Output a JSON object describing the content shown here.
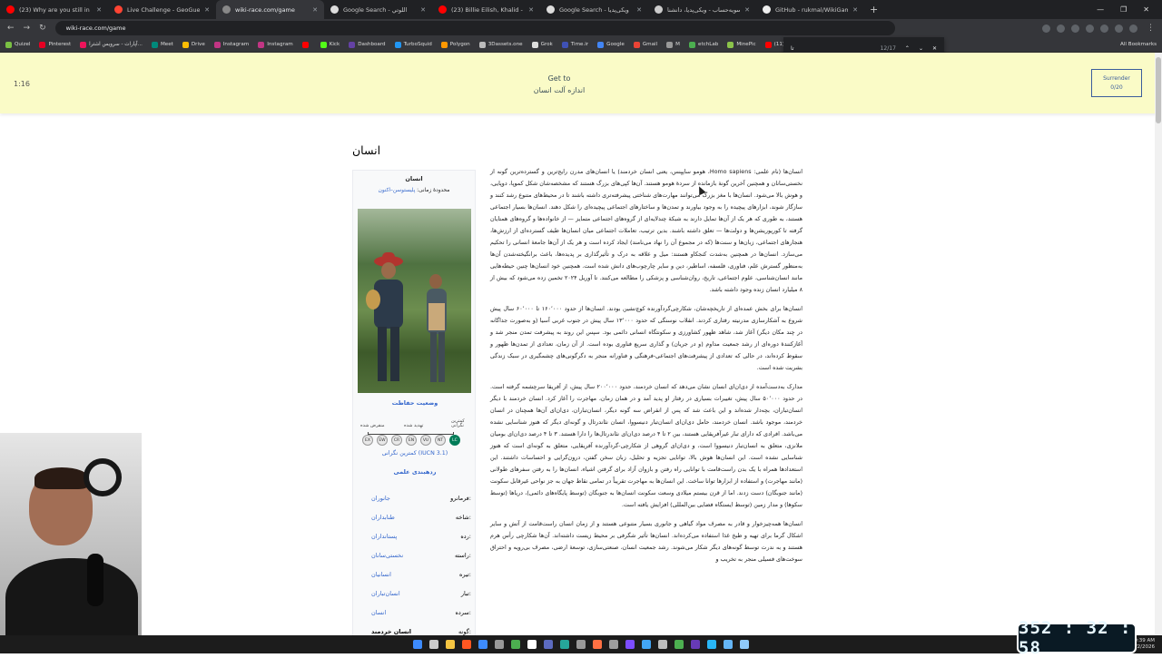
{
  "browser": {
    "tabs": [
      {
        "title": "(23) Why are you still in touch...",
        "fav": "#ff0000",
        "active": false
      },
      {
        "title": "Live Challenge - GeoGuessr",
        "fav": "#ff4433",
        "active": false
      },
      {
        "title": "wiki-race.com/game",
        "fav": "#888888",
        "active": true
      },
      {
        "title": "Google Search - اللوتي",
        "fav": "#dddddd",
        "active": false
      },
      {
        "title": "(23) Billie Eilish, Khalid - lo...",
        "fav": "#ff0000",
        "active": false
      },
      {
        "title": "Google Search - ویکی‌پدیا",
        "fav": "#dddddd",
        "active": false
      },
      {
        "title": "تسویه‌حساب - ویکی‌پدیا، دانشنا...",
        "fav": "#cccccc",
        "active": false
      },
      {
        "title": "GitHub - rukmal/WikiGameHe...",
        "fav": "#eeeeee",
        "active": false
      }
    ],
    "url": "wiki-race.com/game",
    "bookmarks": [
      {
        "label": "Quizel",
        "color": "#7ac043"
      },
      {
        "label": "Pinterest",
        "color": "#e60023"
      },
      {
        "label": "آپارات - سرویس اشترا...",
        "color": "#ed145b"
      },
      {
        "label": "Meet",
        "color": "#00897b"
      },
      {
        "label": "Drive",
        "color": "#fbbc04"
      },
      {
        "label": "Instagram",
        "color": "#c13584"
      },
      {
        "label": "Instagram",
        "color": "#c13584"
      },
      {
        "label": "",
        "color": "#ff0000"
      },
      {
        "label": "Kick",
        "color": "#53fc18"
      },
      {
        "label": "Dashboard",
        "color": "#6441a5"
      },
      {
        "label": "TurboSquid",
        "color": "#2196f3"
      },
      {
        "label": "Polygon",
        "color": "#ff9800"
      },
      {
        "label": "3Dassets.one",
        "color": "#bbbbbb"
      },
      {
        "label": "Grok",
        "color": "#dddddd"
      },
      {
        "label": "Time.ir",
        "color": "#3f51b5"
      },
      {
        "label": "Google",
        "color": "#4285f4"
      },
      {
        "label": "Gmail",
        "color": "#ea4335"
      },
      {
        "label": "M",
        "color": "#999999"
      },
      {
        "label": "etchLab",
        "color": "#4caf50"
      },
      {
        "label": "MinePic",
        "color": "#8bc34a"
      },
      {
        "label": "(11) ASMR | Cerami...",
        "color": "#ff0000"
      }
    ],
    "all_bookmarks": "All Bookmarks",
    "find": {
      "query": "تا",
      "count": "12/17"
    }
  },
  "game": {
    "timer": "1:16",
    "target_label": "Get to",
    "target_value": "اندازه آلت انسان",
    "surrender_label": "Surrender",
    "surrender_count": "0/20"
  },
  "article": {
    "title": "انسان",
    "infobox": {
      "name": "انسان",
      "range_prefix": "محدودهٔ زمانی:",
      "range_link": "پلیستوسن–اکنون",
      "conservation_title": "وضعیت حفاظت",
      "cons_labels": {
        "extinct": "منقرض شده",
        "threatened": "تهدید شده",
        "least": "کمترین نگرانی"
      },
      "cons_codes": [
        "EX",
        "EW",
        "CR",
        "EN",
        "VU",
        "NT",
        "LC"
      ],
      "iucn": "کمترین نگرانی (IUCN 3.1)",
      "taxonomy_title": "ردهبندی علمی",
      "taxonomy": [
        {
          "label": "فرمانرو:",
          "value": "جانوران"
        },
        {
          "label": "شاخه:",
          "value": "طنابداران"
        },
        {
          "label": "رده:",
          "value": "پستانداران"
        },
        {
          "label": "راسته:",
          "value": "نخستی‌سانان"
        },
        {
          "label": "تیره:",
          "value": "انسانیان"
        },
        {
          "label": "تبار:",
          "value": "انسان‌تباران"
        },
        {
          "label": "سرده:",
          "value": "انسان"
        },
        {
          "label": "گونه:",
          "value": "انسان خردمند"
        }
      ]
    },
    "paragraphs": [
      "انسان‌ها (نام علمی: Homo sapiens، هومو ساپیِنس، یعنی انسان خردمند) یا انسان‌های مدرن رایج‌ترین و گسترده‌ترین گونه از نخستی‌سانان و همچنین آخرین گونهٔ بازمانده از سردهٔ هومو هستند. آن‌ها کپی‌های بزرگ هستند که مشخصه‌شان شکل کموپا، دوپایی، و هوش بالا می‌شود. انسان‌ها با مغز بزرگ می‌توانند مهارت‌های شناختی پیشرفته‌تری داشته باشند تا در محیط‌های متنوع رشد کنند و سازگار شوند، ابزارهای پیچیده را به وجود بیاورند و تمدن‌ها و ساختارهای اجتماعی پیچیده‌ای را شکل دهند. انسان‌ها بسیار اجتماعی هستند، به طوری که هر یک از آن‌ها تمایل دارند به شبکهٔ چندلایه‌ای از گروه‌های اجتماعی متمایز — از خانواده‌ها و گروه‌های همتایان گرفته تا کورپوریشن‌ها و دولت‌ها — تعلق داشته باشند. بدین ترتیب، تعاملات اجتماعی میان انسان‌ها طیف گسترده‌ای از ارزش‌ها، هنجارهای اجتماعی، زبان‌ها و سنت‌ها (که در مجموع آن را نهاد می‌نامند) ایجاد کرده است و هر یک از آن‌ها جامعهٔ انسانی را تحکیم می‌سازد. انسان‌ها در همچنین به‌شدت کنجکاو هستند: میل و علاقه به درک و تأثیرگذاری بر پدیده‌ها، باعث برانگیخته‌شدن آن‌ها به‌منظور گسترش علم، فناوری، فلسفه، اساطیر، دین و سایر چارچوب‌های دانش شده است. همچنین خود انسان‌ها چنین حیطه‌هایی مانند انسان‌شناسی، علوم اجتماعی، تاریخ، روان‌شناسی و پزشکی را مطالعه می‌کنند. تا آوریل ۲۰۲۴ تخمین زده می‌شود که بیش از ۸ میلیارد انسان زنده وجود داشته باشد.",
      "انسان‌ها برای بخش عمده‌ای از تاریخچه‌شان، شکارچی‌گردآورنده کوچ‌نشین بودند. انسان‌ها از حدود ۱۶۰٬۰۰۰ تا ۶۰٬۰۰۰ سال پیش شروع به آشکارسازی مدرنیته رفتاری کردند. انقلاب نوسنگی که حدود ۱۳٬۰۰۰ سال پیش در جنوب غربی آسیا (و به‌صورت جداگانه در چند مکان دیگر) آغاز شد، شاهد ظهور کشاورزی و سکونتگاه انسانی دائمی بود. سپس این روند به پیشرفت تمدن منجر شد و آغازکنندهٔ دوره‌ای از رشد جمعیت مداوم (و در جریان) و گذاری سریع فناوری بوده است. از آن زمان، تعدادی از تمدن‌ها ظهور و سقوط کرده‌اند، در حالی که تعدادی از پیشرفت‌های اجتماعی-فرهنگی و فناورانه منجر به دگرگونی‌های چشمگیری در سبک زندگی بشریت شده است.",
      "مدارک به‌دست‌آمده از دی‌ان‌ای انسان نشان می‌دهد که انسان خردمند، حدود ۲۰۰٬۰۰۰ سال پیش، از آفریقا سرچشمه گرفته است. در حدود ۵۰٬۰۰۰ سال پیش، تغییرات بسیاری در رفتار او پدید آمد و در همان زمان، مهاجرت را آغاز کرد. انسان خردمند با دیگر انسان‌تباران، بچه‌دار شده‌اند و این باعث شد که پس از انقراض سه گونه دیگر، انسان‌تباران، دی‌ان‌ای آن‌ها همچنان در انسان خردمند، موجود باشد. انسان خردمند، حامل دی‌ان‌ای انسان‌تبار دنیسووا، انسان نئاندرتال و گونه‌ای دیگر که هنوز شناسایی نشده می‌باشد. افرادی که دارای تبار غیرآفریقایی هستند، بین ۲ تا ۴ درصد دی‌ان‌ای نئاندرتال‌ها را دارا هستند. ۳ تا ۴ درصد دی‌ان‌ای بومیان ملانزی، متعلق به انسان‌تبار دنیسووا است، و دی‌ان‌ای گروهی از شکارچی-گردآورنده آفریقایی، متعلق به گونه‌ای است که هنوز شناسایی نشده است. این انسان‌ها هوش بالا، توانایی تجزیه و تحلیل، زبان سخن گفتن، درون‌گرایی و احساسات داشتند. این استعدادها همراه با یک بدن راست‌قامت با توانایی راه رفتن و بازوان آزاد برای گرفتن اشیاء، انسان‌ها را به رفتن سفرهای طولانی (مانند مهاجرت) و استفاده از ابزارها توانا ساخت. این انسان‌ها به مهاجرت تقریباً در تمامی نقاط جهان به جز نواحی غیرقابل سکونت (مانند جنوبگان) دست زدند. اما از قرن بیستم میلادی وسعت سکونت انسان‌ها به جنوبگان (توسط پایگاه‌های دائمی)، دریاها (توسط سکوها) و مدار زمین (توسط ایستگاه فضایی بین‌المللی) افزایش یافته است.",
      "انسان‌ها همه‌چیزخوار و قادر به مصرف مواد گیاهی و جانوری بسیار متنوعی هستند و از زمان انسان راست‌قامت از آتش و سایر اشکال گرما برای تهیه و طبخ غذا استفاده می‌کرده‌اند. انسان‌ها تأثیر شگرفی بر محیط زیست داشته‌اند. آن‌ها شکارچی رأس هرم هستند و به ندرت توسط گونه‌های دیگر شکار می‌شوند. رشد جمعیت انسان، صنعتی‌سازی، توسعهٔ ارضی، مصرف بی‌رویه و احتراق سوخت‌های فسیلی منجر به تخریب و"
    ]
  },
  "overlay": {
    "countdown": "352 : 32 : 58"
  },
  "taskbar": {
    "icons": [
      "#3d8bfd",
      "#cccccc",
      "#f5c542",
      "#ff5722",
      "#3d8bfd",
      "#999999",
      "#4caf50",
      "#ffffff",
      "#5c6bc0",
      "#26a69a",
      "#999999",
      "#ff7043",
      "#9e9e9e",
      "#7c4dff",
      "#42a5f5",
      "#bdbdbd",
      "#4caf50",
      "#673ab7",
      "#29b6f6",
      "#64b5f6",
      "#90caf9"
    ],
    "time": "9:39 AM",
    "date": "2/2/2026"
  }
}
